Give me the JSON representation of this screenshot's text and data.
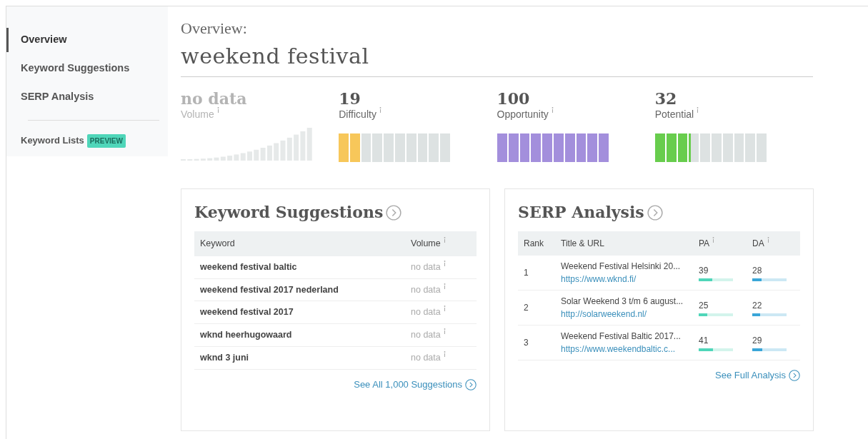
{
  "sidebar": {
    "items": [
      {
        "label": "Overview",
        "selected": true
      },
      {
        "label": "Keyword Suggestions",
        "selected": false
      },
      {
        "label": "SERP Analysis",
        "selected": false
      }
    ],
    "extra": {
      "label": "Keyword Lists",
      "badge": "PREVIEW"
    }
  },
  "header": {
    "subtitle": "Overview:",
    "title": "weekend festival"
  },
  "metrics": [
    {
      "kind": "sparkline",
      "value": "no data",
      "label": "Volume",
      "muted": true
    },
    {
      "kind": "meter",
      "value": "19",
      "label": "Difficulty",
      "muted": false,
      "level": 0.19,
      "color": "#f7c75a"
    },
    {
      "kind": "meter",
      "value": "100",
      "label": "Opportunity",
      "muted": false,
      "level": 1.0,
      "color": "#a38fdc"
    },
    {
      "kind": "meter",
      "value": "32",
      "label": "Potential",
      "muted": false,
      "level": 0.32,
      "color": "#68cd4d"
    }
  ],
  "keyword_suggestions": {
    "title": "Keyword Suggestions",
    "columns": [
      "Keyword",
      "Volume"
    ],
    "rows": [
      [
        "weekend festival baltic",
        "no data"
      ],
      [
        "weekend festival 2017 nederland",
        "no data"
      ],
      [
        "weekend festival 2017",
        "no data"
      ],
      [
        "wknd heerhugowaard",
        "no data"
      ],
      [
        "wknd 3 juni",
        "no data"
      ]
    ],
    "link": "See All 1,000 Suggestions"
  },
  "serp_analysis": {
    "title": "SERP Analysis",
    "columns": [
      "Rank",
      "Title & URL",
      "PA",
      "DA"
    ],
    "rows": [
      {
        "rank": "1",
        "title": "Weekend Festival Helsinki 20...",
        "url": "https://www.wknd.fi/",
        "pa": {
          "value": "39",
          "level": 0.39
        },
        "da": {
          "value": "28",
          "level": 0.28
        }
      },
      {
        "rank": "2",
        "title": "Solar Weekend 3 t/m 6 august...",
        "url": "http://solarweekend.nl/",
        "pa": {
          "value": "25",
          "level": 0.25
        },
        "da": {
          "value": "22",
          "level": 0.22
        }
      },
      {
        "rank": "3",
        "title": "Weekend Festival Baltic 2017...",
        "url": "https://www.weekendbaltic.c...",
        "pa": {
          "value": "41",
          "level": 0.41
        },
        "da": {
          "value": "29",
          "level": 0.29
        }
      }
    ],
    "link": "See Full Analysis"
  }
}
